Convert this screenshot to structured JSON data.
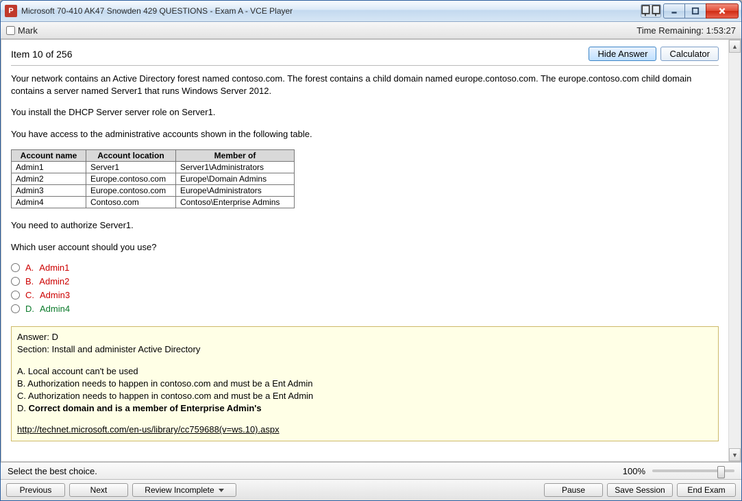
{
  "window": {
    "title": "Microsoft 70-410 AK47 Snowden 429 QUESTIONS - Exam A - VCE Player",
    "app_icon_letter": "P"
  },
  "subbar": {
    "mark_label": "Mark",
    "time_label": "Time Remaining: ",
    "time_value": "1:53:27"
  },
  "toolbar": {
    "item_label": "Item 10 of 256",
    "hide_answer": "Hide Answer",
    "calculator": "Calculator"
  },
  "question": {
    "p1": "Your network contains an Active Directory forest named contoso.com. The forest contains a child domain named europe.contoso.com. The europe.contoso.com child domain contains a server named Server1 that runs Windows Server 2012.",
    "p2": "You install the DHCP Server server role on Server1.",
    "p3": "You have access to the administrative accounts shown in the following table.",
    "p4": "You need to authorize Server1.",
    "p5": "Which user account should you use?"
  },
  "table": {
    "headers": [
      "Account name",
      "Account location",
      "Member of"
    ],
    "rows": [
      [
        "Admin1",
        "Server1",
        "Server1\\Administrators"
      ],
      [
        "Admin2",
        "Europe.contoso.com",
        "Europe\\Domain Admins"
      ],
      [
        "Admin3",
        "Europe.contoso.com",
        "Europe\\Administrators"
      ],
      [
        "Admin4",
        "Contoso.com",
        "Contoso\\Enterprise Admins"
      ]
    ]
  },
  "options": [
    {
      "letter": "A.",
      "text": "Admin1",
      "correct": false
    },
    {
      "letter": "B.",
      "text": "Admin2",
      "correct": false
    },
    {
      "letter": "C.",
      "text": "Admin3",
      "correct": false
    },
    {
      "letter": "D.",
      "text": "Admin4",
      "correct": true
    }
  ],
  "answer": {
    "line1": "Answer: D",
    "line2": "Section: Install and administer Active Directory",
    "expA": "A. Local account can't be used",
    "expB": "B. Authorization needs to happen in contoso.com and must be a Ent Admin",
    "expC": "C. Authorization needs to happen in contoso.com and must be a Ent Admin",
    "expD_prefix": "D. ",
    "expD_bold": "Correct domain and is a member of Enterprise Admin's",
    "link": "http://technet.microsoft.com/en-us/library/cc759688(v=ws.10).aspx"
  },
  "status": {
    "instruction": "Select the best choice.",
    "zoom": "100%"
  },
  "nav": {
    "previous": "Previous",
    "next": "Next",
    "review": "Review Incomplete",
    "pause": "Pause",
    "save": "Save Session",
    "end": "End Exam"
  }
}
